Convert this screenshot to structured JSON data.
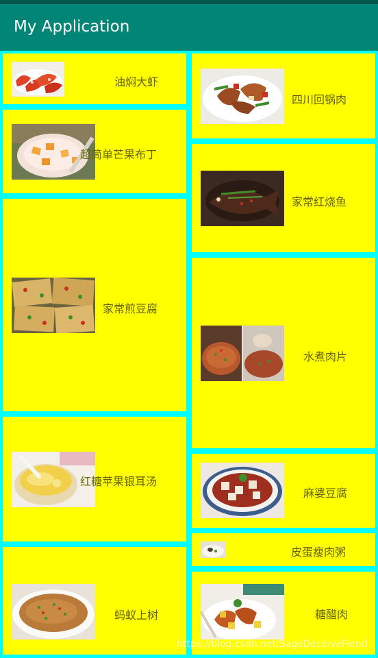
{
  "app": {
    "title": "My Application"
  },
  "dishes": {
    "left": [
      {
        "name": "油焖大虾",
        "image_icon": "braised-shrimp-photo-icon"
      },
      {
        "name": "超简单芒果布丁",
        "image_icon": "mango-pudding-photo-icon"
      },
      {
        "name": "家常煎豆腐",
        "image_icon": "pan-fried-tofu-photo-icon"
      },
      {
        "name": "红糖苹果银耳汤",
        "image_icon": "apple-tremella-soup-photo-icon"
      },
      {
        "name": "蚂蚁上树",
        "image_icon": "ants-climbing-tree-photo-icon"
      }
    ],
    "right": [
      {
        "name": "四川回锅肉",
        "image_icon": "twice-cooked-pork-photo-icon"
      },
      {
        "name": "家常红烧鱼",
        "image_icon": "braised-fish-photo-icon"
      },
      {
        "name": "水煮肉片",
        "image_icon": "boiled-pork-slices-photo-icon"
      },
      {
        "name": "麻婆豆腐",
        "image_icon": "mapo-tofu-photo-icon"
      },
      {
        "name": "皮蛋瘦肉粥",
        "image_icon": "century-egg-congee-photo-icon"
      },
      {
        "name": "糖醋肉",
        "image_icon": "sweet-sour-pork-photo-icon"
      }
    ]
  },
  "watermark": "https://blog.csdn.net/SageDeceiveFiend",
  "colors": {
    "app_bar": "#008577",
    "status_bar": "#00574B",
    "background": "#00FFFF",
    "card": "#FFFF00",
    "item_text": "#666600"
  }
}
